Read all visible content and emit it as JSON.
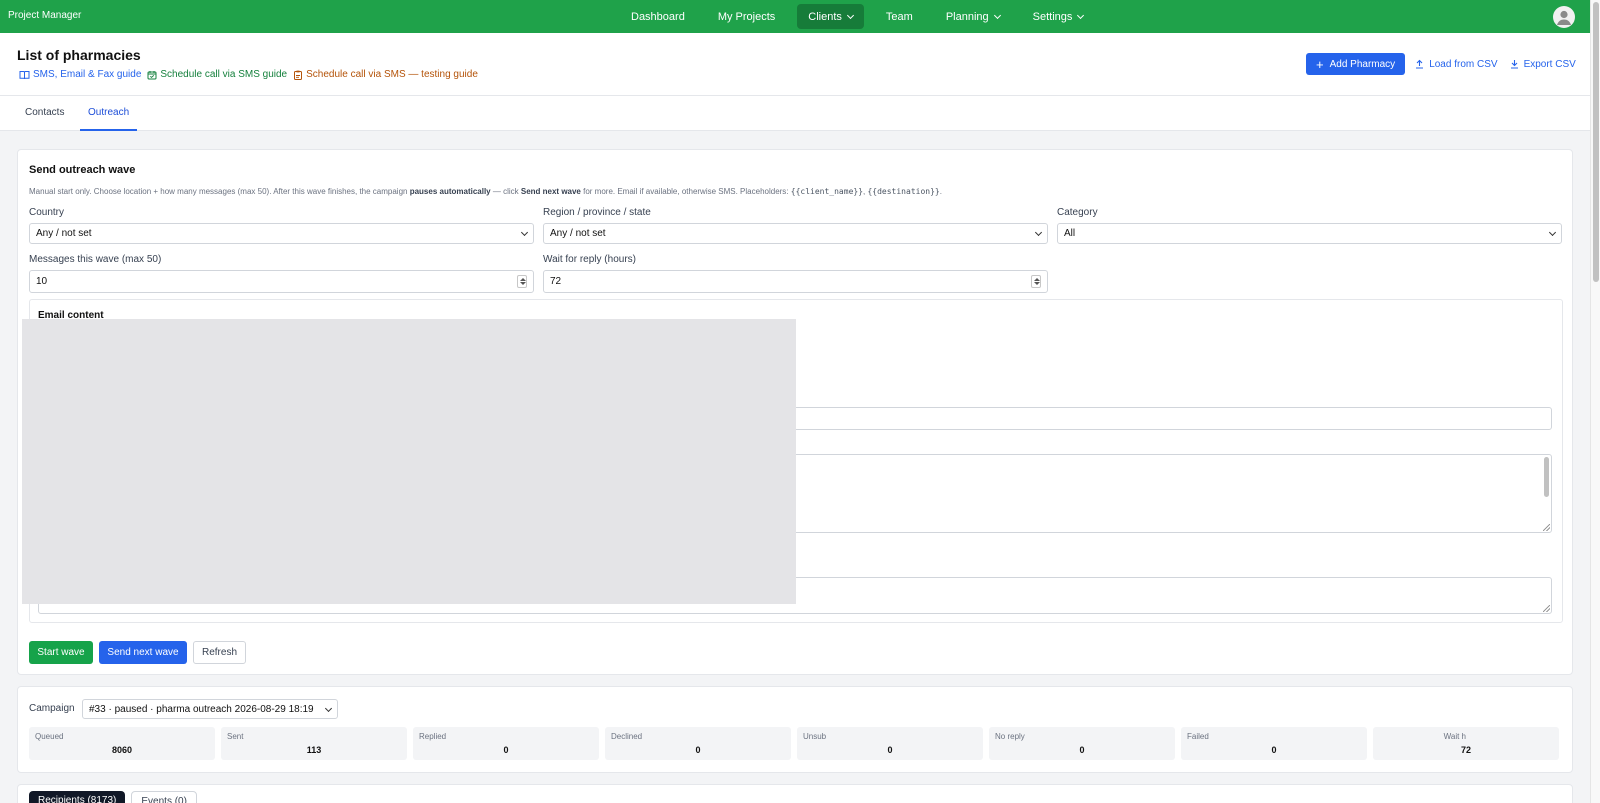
{
  "app": {
    "brand": "Project Manager"
  },
  "nav": {
    "items": [
      {
        "label": "Dashboard",
        "dropdown": false,
        "active": false
      },
      {
        "label": "My Projects",
        "dropdown": false,
        "active": false
      },
      {
        "label": "Clients",
        "dropdown": true,
        "active": true
      },
      {
        "label": "Team",
        "dropdown": false,
        "active": false
      },
      {
        "label": "Planning",
        "dropdown": true,
        "active": false
      },
      {
        "label": "Settings",
        "dropdown": true,
        "active": false
      }
    ]
  },
  "header": {
    "title": "List of pharmacies",
    "guides": [
      {
        "label": "SMS, Email & Fax guide",
        "icon": "book-icon",
        "color": "#2563eb"
      },
      {
        "label": "Schedule call via SMS guide",
        "icon": "calendar-icon",
        "color": "#15803d"
      },
      {
        "label": "Schedule call via SMS — testing guide",
        "icon": "clipboard-icon",
        "color": "#b45309"
      }
    ],
    "actions": {
      "add": "Add Pharmacy",
      "load": "Load from CSV",
      "export": "Export CSV"
    }
  },
  "tabs": [
    {
      "label": "Contacts",
      "active": false
    },
    {
      "label": "Outreach",
      "active": true
    }
  ],
  "wave": {
    "title": "Send outreach wave",
    "help": {
      "p1": "Manual start only. Choose location + how many messages (max 50). After this wave finishes, the campaign ",
      "b1": "pauses automatically",
      "p2": " — click ",
      "b2": "Send next wave",
      "p3": " for more. Email if available, otherwise SMS. Placeholders: ",
      "c1": "{{client_name}}",
      "p4": ", ",
      "c2": "{{destination}}",
      "p5": "."
    },
    "country": {
      "label": "Country",
      "value": "Any / not set"
    },
    "region": {
      "label": "Region / province / state",
      "value": "Any / not set"
    },
    "category": {
      "label": "Category",
      "value": "All"
    },
    "messages": {
      "label": "Messages this wave (max 50)",
      "value": "10"
    },
    "wait": {
      "label": "Wait for reply (hours)",
      "value": "72"
    },
    "email": {
      "title": "Email content"
    },
    "buttons": {
      "start": "Start wave",
      "next": "Send next wave",
      "refresh": "Refresh"
    }
  },
  "campaign": {
    "label": "Campaign",
    "selected": "#33 · paused · pharma outreach 2026-08-29 18:19",
    "stats": [
      {
        "label": "Queued",
        "value": "8060"
      },
      {
        "label": "Sent",
        "value": "113"
      },
      {
        "label": "Replied",
        "value": "0"
      },
      {
        "label": "Declined",
        "value": "0"
      },
      {
        "label": "Unsub",
        "value": "0"
      },
      {
        "label": "No reply",
        "value": "0"
      },
      {
        "label": "Failed",
        "value": "0"
      },
      {
        "label": "Wait h",
        "value": "72"
      }
    ]
  },
  "bottom_tabs": [
    {
      "label": "Recipients (8173)",
      "active": true
    },
    {
      "label": "Events (0)",
      "active": false
    }
  ],
  "colors": {
    "navbar": "#1fa24a",
    "primary": "#2563eb",
    "success": "#16a34a"
  }
}
